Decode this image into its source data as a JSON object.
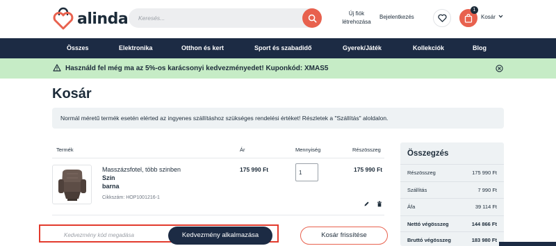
{
  "brand": {
    "name": "alinda",
    "accent": "#e8614e",
    "navy": "#1c2b44"
  },
  "search": {
    "placeholder": "Keresés..."
  },
  "header": {
    "account_line1": "Új fiók",
    "account_line2": "létrehozása",
    "login": "Bejelentkezés",
    "cart_count": "1",
    "cart_label": "Kosár"
  },
  "nav": {
    "items": [
      {
        "label": "Összes"
      },
      {
        "label": "Elektronika"
      },
      {
        "label": "Otthon és kert"
      },
      {
        "label": "Sport és szabadidő"
      },
      {
        "label": "Gyerek/Játék"
      },
      {
        "label": "Kollekciók"
      },
      {
        "label": "Blog"
      }
    ]
  },
  "promo": {
    "text": "Használd fel még ma az 5%-os karácsonyi kedvezményedet! Kuponkód: XMAS5"
  },
  "page": {
    "title": "Kosár"
  },
  "info": {
    "text": "Normál méretű termék esetén elérted az ingyenes szállításhoz szükséges rendelési értéket! Részletek a \"Szállítás\" aloldalon."
  },
  "table": {
    "headers": {
      "product": "Termék",
      "price": "Ár",
      "quantity": "Mennyiség",
      "subtotal": "Részösszeg"
    },
    "rows": [
      {
        "name": "Masszázsfotel, több szinben",
        "attr_label": "Szín",
        "attr_value": "barna",
        "sku": "Cikkszám: HOP1001216-1",
        "price": "175 990 Ft",
        "quantity": "1",
        "subtotal": "175 990 Ft"
      }
    ]
  },
  "coupon": {
    "placeholder": "Kedvezmény kód megadása",
    "apply_label": "Kedvezmény alkalmazása",
    "refresh_label": "Kosár frissítése"
  },
  "summary": {
    "title": "Összegzés",
    "rows": [
      {
        "label": "Részösszeg",
        "value": "175 990 Ft"
      },
      {
        "label": "Szállítás",
        "value": "7 990 Ft"
      },
      {
        "label": "Áfa",
        "value": "39 114 Ft"
      },
      {
        "label": "Nettó végösszeg",
        "value": "144 866 Ft"
      },
      {
        "label": "Bruttó végösszeg",
        "value": "183 980 Ft"
      }
    ]
  }
}
